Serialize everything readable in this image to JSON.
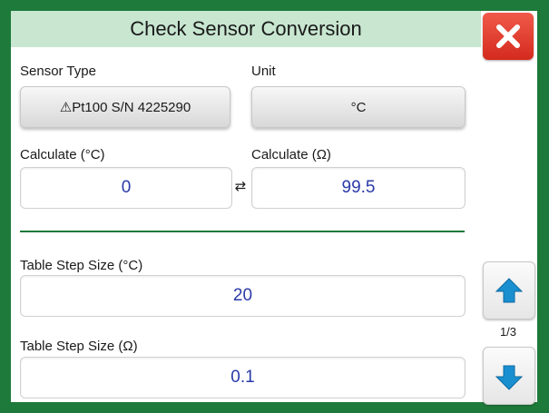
{
  "window": {
    "title": "Check Sensor Conversion"
  },
  "sensor_type": {
    "label": "Sensor Type",
    "warning_symbol": "⚠",
    "value": "Pt100 S/N 4225290"
  },
  "unit": {
    "label": "Unit",
    "value": "°C"
  },
  "calc_temp": {
    "label": "Calculate (°C)",
    "value": "0"
  },
  "calc_res": {
    "label": "Calculate (Ω)",
    "value": "99.5"
  },
  "swap_symbol": "⇄",
  "step_temp": {
    "label": "Table Step Size (°C)",
    "value": "20"
  },
  "step_res": {
    "label": "Table Step Size (Ω)",
    "value": "0.1"
  },
  "pager": {
    "indicator": "1/3"
  },
  "colors": {
    "frame": "#1e7a3a",
    "title_bg": "#c8e6d0",
    "close": "#e03a2c",
    "value_text": "#2a3aa8",
    "arrow": "#1a8fd0"
  },
  "icons": {
    "close": "close-icon",
    "up": "arrow-up-icon",
    "down": "arrow-down-icon",
    "warning": "warning-icon"
  }
}
